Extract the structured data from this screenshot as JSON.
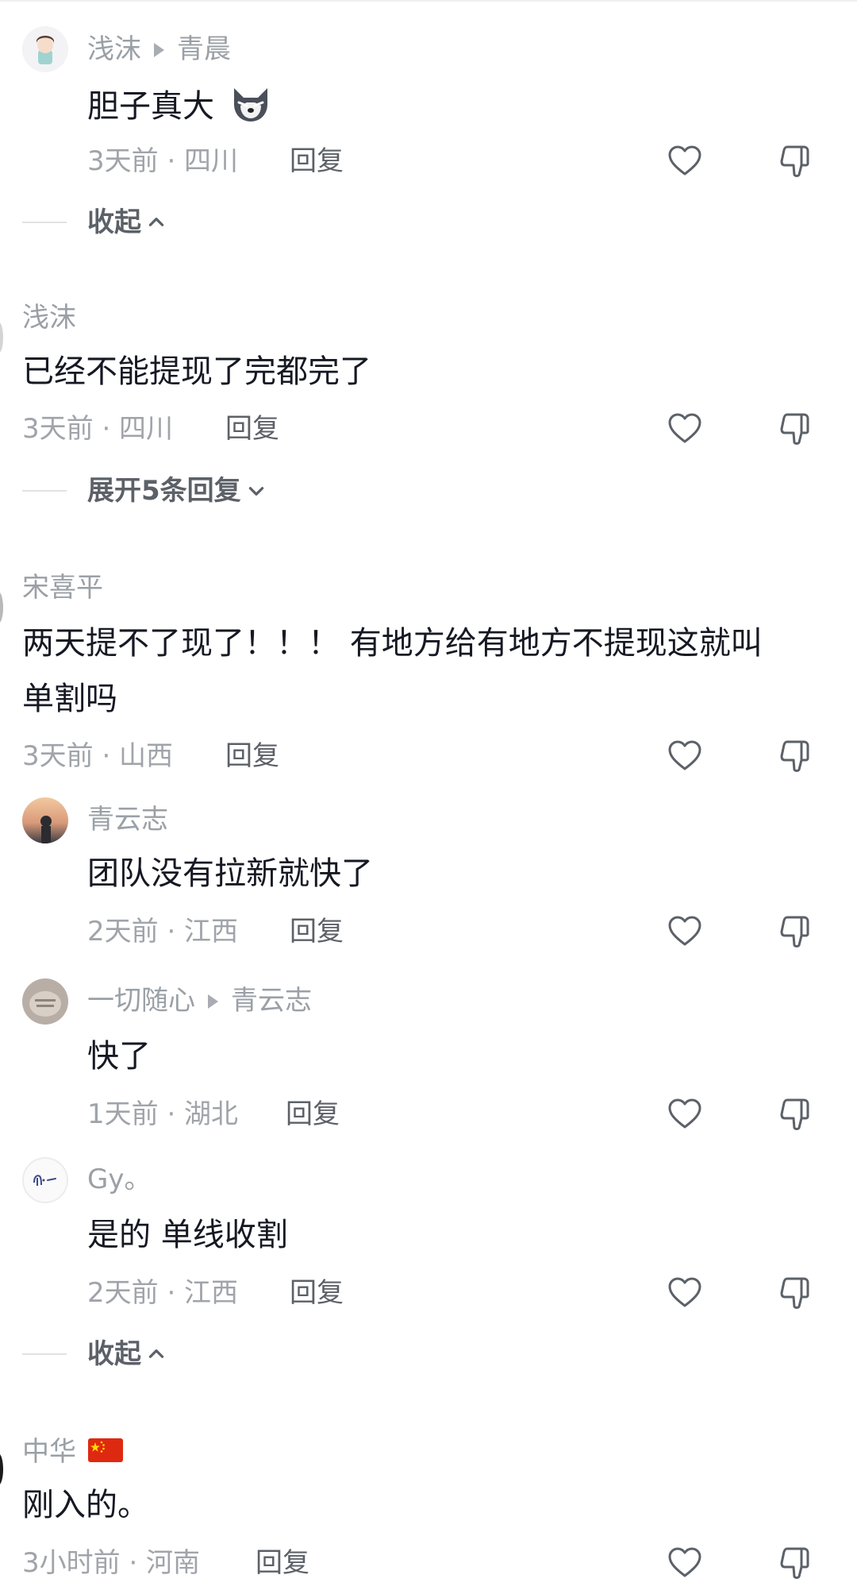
{
  "comments": [
    {
      "name": "浅沫",
      "reply_to": "青晨",
      "text": "胆子真大",
      "emoji": "wolf-face-emoji",
      "time_location": "3天前 · 四川",
      "reply_label": "回复"
    },
    {
      "name": "浅沫",
      "text": "已经不能提现了完都完了",
      "time_location": "3天前 · 四川",
      "reply_label": "回复"
    },
    {
      "name": "宋喜平",
      "text_lines": [
        "两天提不了现了！！！ 有地方给有地方不提现这就叫",
        "单割吗"
      ],
      "time_location": "3天前 · 山西",
      "reply_label": "回复"
    },
    {
      "name": "青云志",
      "text": "团队没有拉新就快了",
      "time_location": "2天前 · 江西",
      "reply_label": "回复"
    },
    {
      "name": "一切随心",
      "reply_to": "青云志",
      "text": "快了",
      "time_location": "1天前 · 湖北",
      "reply_label": "回复"
    },
    {
      "name": "Gy。",
      "text": "是的 单线收割",
      "time_location": "2天前 · 江西",
      "reply_label": "回复"
    },
    {
      "name": "中华",
      "flag": "china-flag-emoji",
      "text": "刚入的。",
      "time_location": "3小时前 · 河南",
      "reply_label": "回复"
    }
  ],
  "threads": {
    "collapse_label_1": "收起",
    "expand_label": "展开5条回复",
    "collapse_label_2": "收起"
  },
  "icons": {
    "like": "heart-outline-icon",
    "dislike": "thumbs-down-outline-icon"
  },
  "colors": {
    "name": "#9aa0a6",
    "text": "#161823",
    "meta": "#a0a4aa",
    "reply": "#5c6168"
  }
}
